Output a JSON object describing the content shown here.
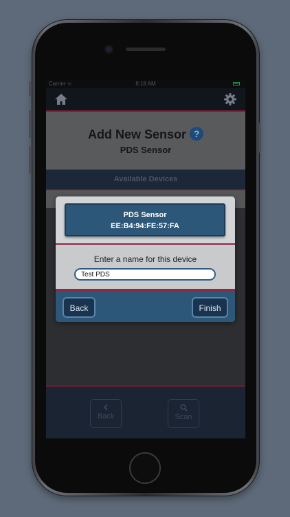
{
  "status_bar": {
    "carrier": "Carrier ᯤ",
    "time": "8:18 AM"
  },
  "screen": {
    "title": "Add New Sensor",
    "help_symbol": "?",
    "subtitle": "PDS Sensor",
    "section_header": "Available Devices"
  },
  "bottom_bar": {
    "back_label": "Back",
    "scan_label": "Scan"
  },
  "dialog": {
    "device_name": "PDS Sensor",
    "device_address": "EE:B4:94:FE:57:FA",
    "prompt": "Enter a name for this device",
    "name_value": "Test PDS",
    "back_label": "Back",
    "finish_label": "Finish"
  },
  "colors": {
    "accent_blue": "#2d5778",
    "accent_red": "#8a2a45",
    "nav_dark": "#11151c"
  }
}
